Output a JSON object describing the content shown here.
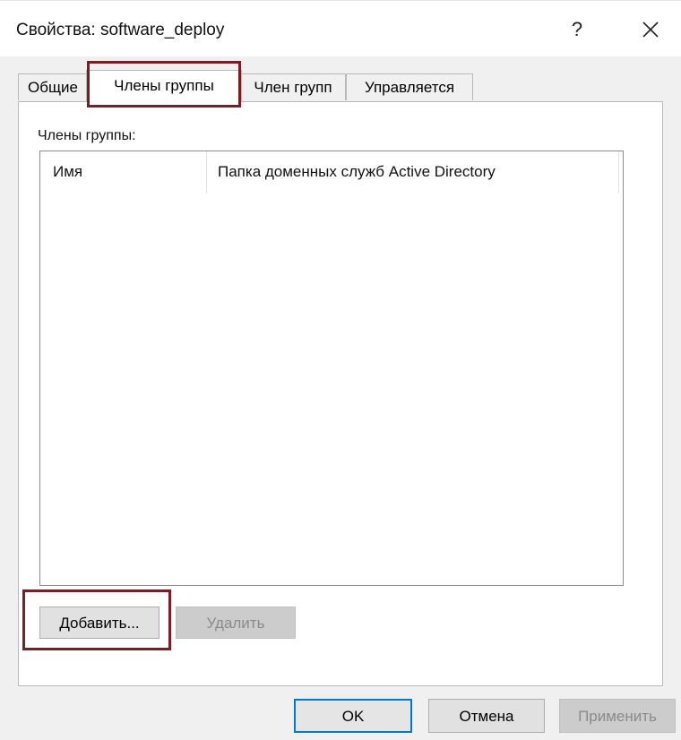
{
  "window": {
    "title": "Свойства: software_deploy",
    "help": "?"
  },
  "tabs": [
    {
      "label": "Общие",
      "active": false
    },
    {
      "label": "Члены группы",
      "active": true
    },
    {
      "label": "Член групп",
      "active": false
    },
    {
      "label": "Управляется",
      "active": false
    }
  ],
  "members": {
    "label": "Члены группы:",
    "columns": [
      "Имя",
      "Папка доменных служб Active Directory"
    ],
    "rows": []
  },
  "actions": {
    "add": "Добавить...",
    "remove": "Удалить"
  },
  "footer": {
    "ok": "OK",
    "cancel": "Отмена",
    "apply": "Применить"
  },
  "colors": {
    "highlight": "#7b1c26",
    "focus": "#0078d7"
  }
}
